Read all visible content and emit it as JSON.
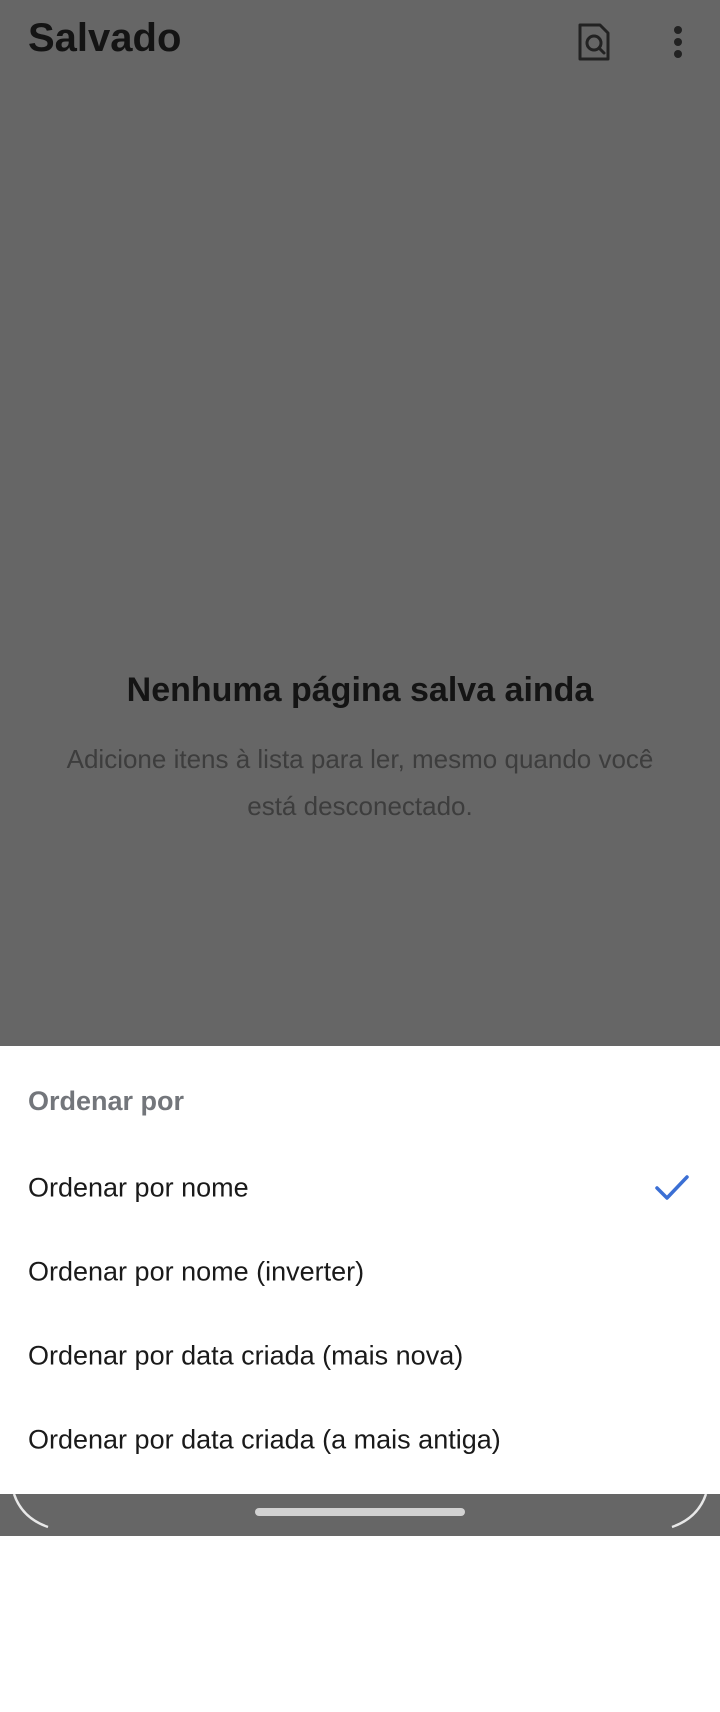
{
  "appbar": {
    "title": "Salvado",
    "icons": [
      "search-page-icon",
      "more-vert-icon"
    ]
  },
  "empty_state": {
    "title": "Nenhuma página salva ainda",
    "description": "Adicione itens à lista para ler, mesmo quando você está desconectado."
  },
  "sort_sheet": {
    "header": "Ordenar por",
    "options": [
      {
        "label": "Ordenar por nome",
        "selected": true
      },
      {
        "label": "Ordenar por nome (inverter)",
        "selected": false
      },
      {
        "label": "Ordenar por data criada (mais nova)",
        "selected": false
      },
      {
        "label": "Ordenar por data criada (a mais antiga)",
        "selected": false
      }
    ]
  },
  "colors": {
    "scrim": "#666666",
    "accent": "#3b6fd4",
    "sheet_background": "#ffffff",
    "header_text": "#73767b"
  }
}
